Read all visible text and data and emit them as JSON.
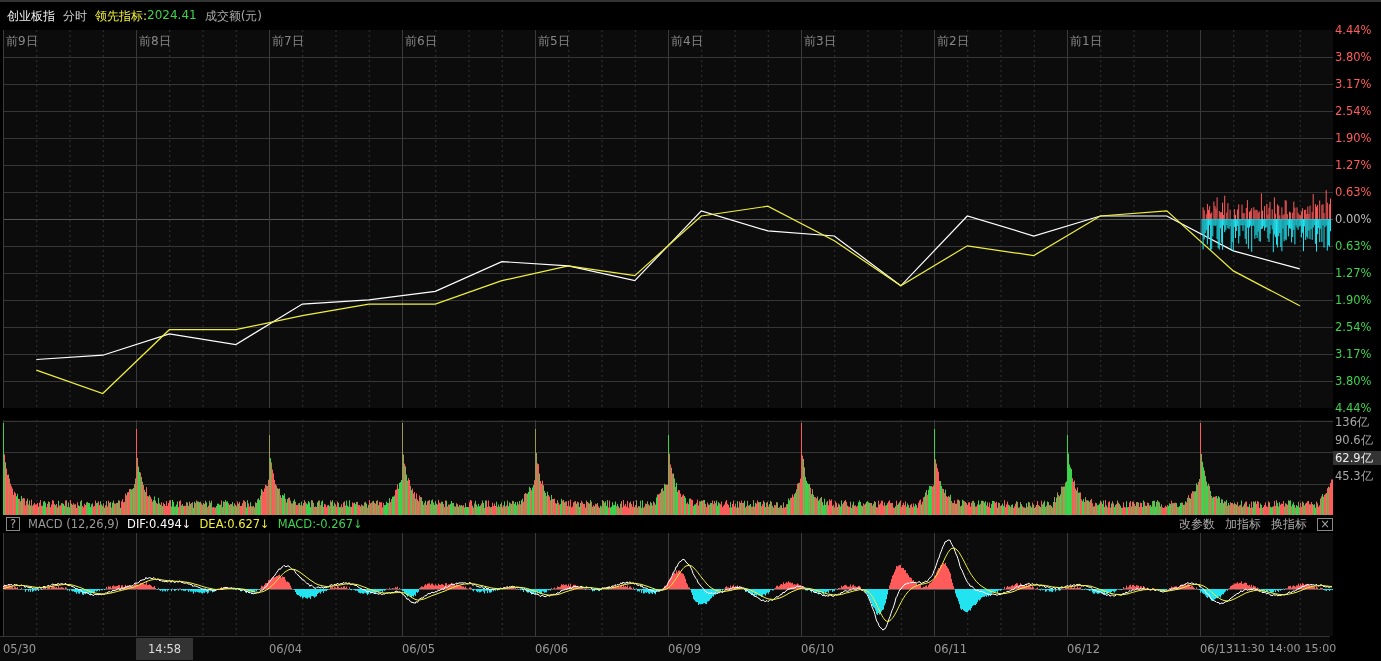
{
  "header": {
    "index_name": "创业板指",
    "mode": "分时",
    "indicator_label": "领先指标:",
    "indicator_value": "2024.41",
    "volume_label": "成交额(元)"
  },
  "price_chart": {
    "day_labels": [
      "前9日",
      "前8日",
      "前7日",
      "前6日",
      "前5日",
      "前4日",
      "前3日",
      "前2日",
      "前1日"
    ],
    "chart_data": {
      "type": "line",
      "categories": [
        null,
        null,
        null,
        null,
        null,
        null,
        null,
        null,
        null,
        null,
        null,
        null,
        null,
        null,
        null,
        null,
        null,
        null,
        null,
        null
      ],
      "ylim": [
        -4.44,
        4.44
      ],
      "grid": true,
      "yticks": [
        {
          "value": 4.44,
          "label": "4.44%"
        },
        {
          "value": 3.8,
          "label": "3.80%"
        },
        {
          "value": 3.17,
          "label": "3.17%"
        },
        {
          "value": 2.54,
          "label": "2.54%"
        },
        {
          "value": 1.9,
          "label": "1.90%"
        },
        {
          "value": 1.27,
          "label": "1.27%"
        },
        {
          "value": 0.63,
          "label": "0.63%"
        },
        {
          "value": 0,
          "label": "0.00%"
        },
        {
          "value": -0.63,
          "label": "0.63%"
        },
        {
          "value": -1.27,
          "label": "1.27%"
        },
        {
          "value": -1.9,
          "label": "1.90%"
        },
        {
          "value": -2.54,
          "label": "2.54%"
        },
        {
          "value": -3.17,
          "label": "3.17%"
        },
        {
          "value": -3.8,
          "label": "3.80%"
        },
        {
          "value": -4.44,
          "label": "4.44%"
        }
      ],
      "series": [
        {
          "color": "#ffffff",
          "values": [
            -3.3,
            -3.2,
            -2.7,
            -2.95,
            -2.0,
            -1.9,
            -1.7,
            -1.0,
            -1.1,
            -1.45,
            0.19,
            -0.28,
            -0.4,
            -1.57,
            0.07,
            -0.4,
            0.07,
            0.07,
            -0.75,
            -1.17
          ]
        },
        {
          "color": "#f0f03c",
          "values": [
            -3.55,
            -4.1,
            -2.6,
            -2.6,
            -2.27,
            -2.0,
            -2.0,
            -1.45,
            -1.1,
            -1.33,
            0.07,
            0.3,
            -0.51,
            -1.57,
            -0.63,
            -0.86,
            0.07,
            0.19,
            -1.22,
            -2.04
          ]
        }
      ]
    }
  },
  "volume_chart": {
    "axis_labels": [
      "136亿",
      "90.6亿",
      "45.3亿"
    ],
    "current_value": "62.9亿"
  },
  "macd_bar": {
    "help": "?",
    "title": "MACD (12,26,9)",
    "readings": [
      {
        "text": "DIF:0.494↓",
        "color": "#ffffff"
      },
      {
        "text": "DEA:0.627↓",
        "color": "#f0f03c"
      },
      {
        "text": "MACD:-0.267↓",
        "color": "#3dd34d"
      }
    ],
    "buttons": [
      "改参数",
      "加指标",
      "换指标"
    ],
    "close": "×"
  },
  "time_axis": {
    "labels": [
      {
        "text": "05/30",
        "highlighted": false
      },
      {
        "text": "14:58",
        "highlighted": true
      },
      {
        "text": "06/04",
        "highlighted": false
      },
      {
        "text": "06/05",
        "highlighted": false
      },
      {
        "text": "06/06",
        "highlighted": false
      },
      {
        "text": "06/09",
        "highlighted": false
      },
      {
        "text": "06/10",
        "highlighted": false
      },
      {
        "text": "06/11",
        "highlighted": false
      },
      {
        "text": "06/12",
        "highlighted": false
      },
      {
        "text": "06/13",
        "highlighted": false
      }
    ],
    "session_labels": [
      "11:30",
      "14:00",
      "15:00"
    ]
  }
}
